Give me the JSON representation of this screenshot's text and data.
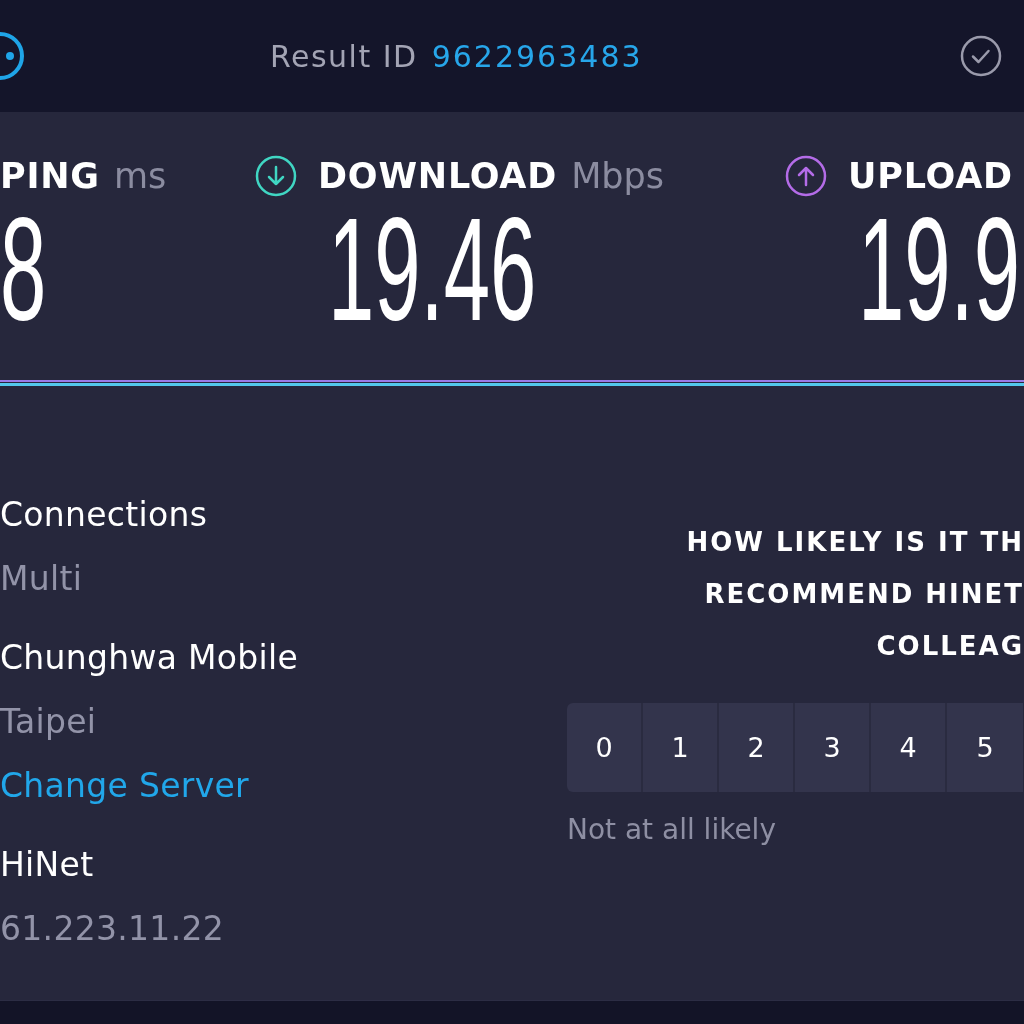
{
  "top_bar": {
    "result_label": "Result ID",
    "result_id": "9622963483"
  },
  "metrics": [
    {
      "kind": "ping",
      "label": "PING",
      "unit": "ms",
      "value": "8"
    },
    {
      "kind": "download",
      "label": "DOWNLOAD",
      "unit": "Mbps",
      "value": "19.46",
      "color": "#40d6c3"
    },
    {
      "kind": "upload",
      "label": "UPLOAD",
      "value": "19.9",
      "color": "#b46ce8"
    }
  ],
  "connection": {
    "connections_label": "Connections",
    "connections_value": "Multi",
    "server_name": "Chunghwa Mobile",
    "server_location": "Taipei",
    "change_server": "Change Server",
    "isp_name": "HiNet",
    "ip_address": "61.223.11.22"
  },
  "survey": {
    "question_lines": [
      "HOW LIKELY IS IT TH",
      "RECOMMEND HINET",
      "COLLEAG"
    ],
    "options": [
      {
        "label": "0",
        "selected": false
      },
      {
        "label": "1",
        "selected": false
      },
      {
        "label": "2",
        "selected": false
      },
      {
        "label": "3",
        "selected": false
      },
      {
        "label": "4",
        "selected": false
      },
      {
        "label": "5",
        "selected": false
      }
    ],
    "min_label": "Not at all likely"
  }
}
